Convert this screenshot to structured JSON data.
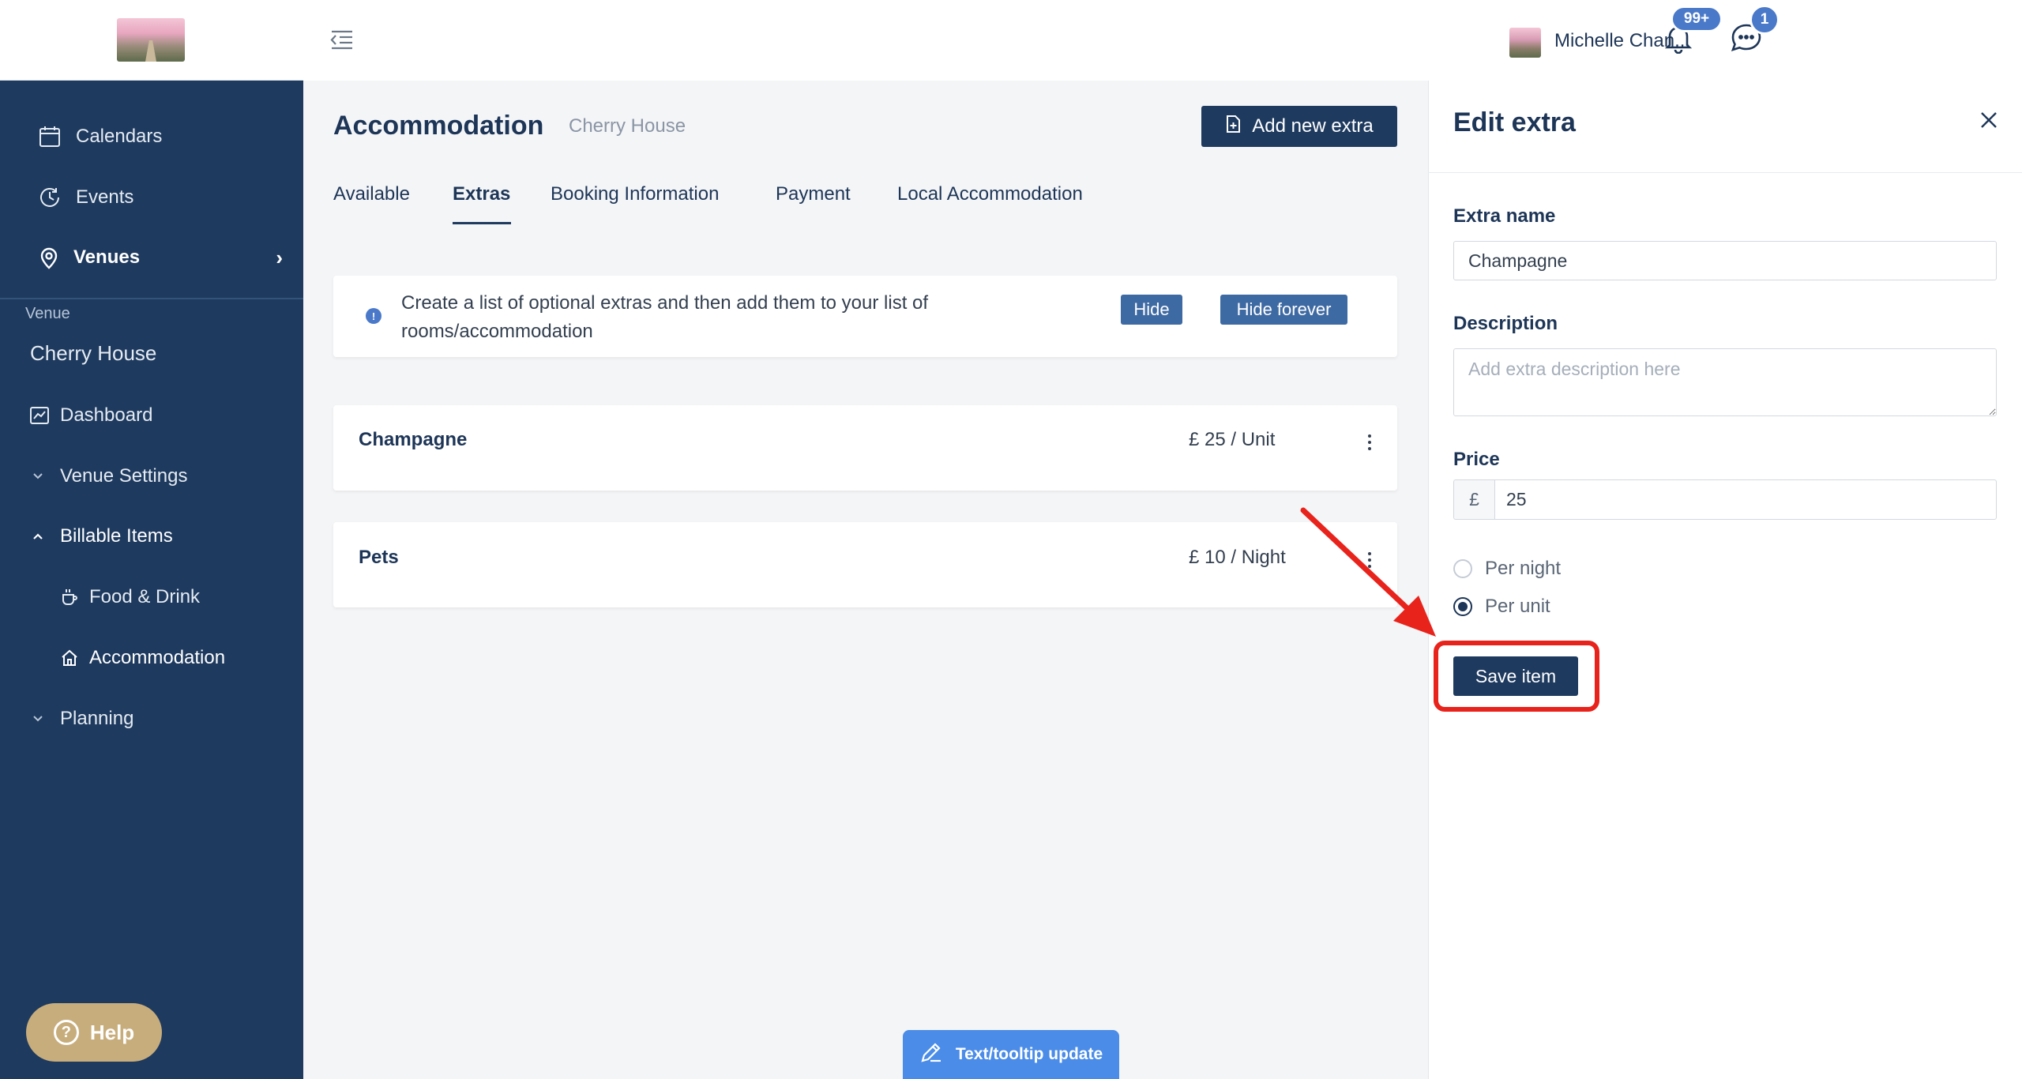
{
  "sidebar": {
    "nav": [
      {
        "label": "Calendars",
        "icon": "calendar-icon"
      },
      {
        "label": "Events",
        "icon": "clock-history-icon"
      },
      {
        "label": "Venues",
        "icon": "location-pin-icon"
      }
    ],
    "venue_caption": "Venue",
    "venue_name": "Cherry House",
    "venue_nav": [
      {
        "label": "Dashboard",
        "icon": "chart-icon"
      },
      {
        "label": "Venue Settings",
        "icon": "chevron-down-icon"
      },
      {
        "label": "Billable Items",
        "icon": "chevron-up-icon"
      },
      {
        "label": "Food & Drink",
        "icon": "coffee-cup-icon"
      },
      {
        "label": "Accommodation",
        "icon": "home-icon"
      },
      {
        "label": "Planning",
        "icon": "chevron-down-icon"
      }
    ],
    "help_label": "Help"
  },
  "topbar": {
    "notifications_badge": "99+",
    "messages_badge": "1",
    "user_name": "Michelle Chan..."
  },
  "main": {
    "title": "Accommodation",
    "subtitle": "Cherry House",
    "add_button": "Add new extra",
    "tabs": [
      {
        "label": "Available"
      },
      {
        "label": "Extras",
        "active": true
      },
      {
        "label": "Booking Information"
      },
      {
        "label": "Payment"
      },
      {
        "label": "Local Accommodation"
      }
    ],
    "info": {
      "text": "Create a list of optional extras and then add them to your list of rooms/accommodation",
      "hide_label": "Hide",
      "hide_forever_label": "Hide forever"
    },
    "extras": [
      {
        "name": "Champagne",
        "price": "£ 25 / Unit"
      },
      {
        "name": "Pets",
        "price": "£ 10 / Night"
      }
    ],
    "tooltip_button": "Text/tooltip update"
  },
  "edit_panel": {
    "title": "Edit extra",
    "close_label": "X",
    "extra_name_label": "Extra name",
    "extra_name_value": "Champagne",
    "description_label": "Description",
    "description_placeholder": "Add extra description here",
    "price_label": "Price",
    "currency_symbol": "£",
    "price_value": "25",
    "options": [
      {
        "label": "Per night",
        "checked": false
      },
      {
        "label": "Per unit",
        "checked": true
      }
    ],
    "save_label": "Save item"
  },
  "colors": {
    "sidebar_bg": "#1e3a5f",
    "primary": "#1e3a5f",
    "accent_blue": "#4a79c9",
    "annotation_red": "#e8231c",
    "help_gold": "#c8ad7c"
  }
}
